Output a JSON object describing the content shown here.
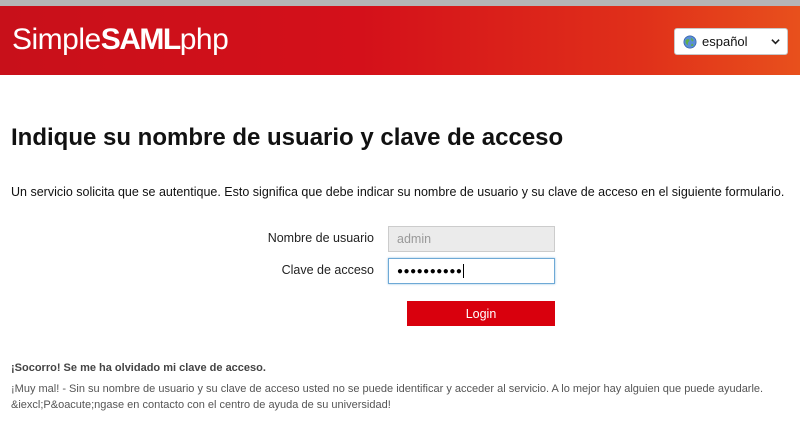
{
  "header": {
    "logo_prefix": "Simple",
    "logo_bold": "SAML",
    "logo_suffix": "php",
    "language_selected": "español",
    "brand_color": "#d9000d"
  },
  "main": {
    "title": "Indique su nombre de usuario y clave de acceso",
    "intro": "Un servicio solicita que se autentique. Esto significa que debe indicar su nombre de usuario y su clave de acceso en el siguiente formulario."
  },
  "form": {
    "username_label": "Nombre de usuario",
    "username_value": "admin",
    "password_label": "Clave de acceso",
    "password_mask": "●●●●●●●●●●",
    "login_label": "Login"
  },
  "help": {
    "title": "¡Socorro! Se me ha olvidado mi clave de acceso.",
    "text_line1": "¡Muy mal! - Sin su nombre de usuario y su clave de acceso usted no se puede identificar y acceder al servicio. A lo mejor hay alguien que puede ayudarle.",
    "text_line2": "&iexcl;P&oacute;ngase en contacto con el centro de ayuda de su universidad!"
  },
  "icons": {
    "language": "globe-icon",
    "dropdown": "chevron-down-icon"
  }
}
